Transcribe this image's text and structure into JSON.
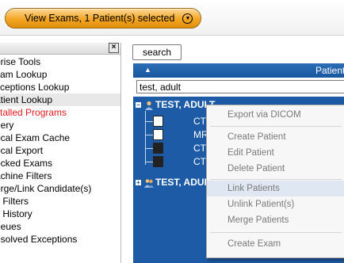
{
  "banner": {
    "button_label": "View Exams, 1 Patient(s) selected"
  },
  "left_panel": {
    "items": [
      {
        "label": "prise Tools"
      },
      {
        "label": "kam Lookup"
      },
      {
        "label": "xceptions Lookup"
      },
      {
        "label": "atient Lookup",
        "selected": true
      },
      {
        "label": "stalled Programs",
        "color": "#e5191f"
      },
      {
        "label": "uery"
      },
      {
        "label": "ocal Exam Cache"
      },
      {
        "label": "ocal Export"
      },
      {
        "label": "ocked Exams"
      },
      {
        "label": "achine Filters"
      },
      {
        "label": "erge/Link Candidate(s)"
      },
      {
        "label": "y Filters"
      },
      {
        "label": "y History"
      },
      {
        "label": "ueues"
      },
      {
        "label": "esolved Exceptions"
      }
    ]
  },
  "search": {
    "label": "search"
  },
  "patient_table": {
    "column_header": "Patient",
    "filter_value": "test, adult",
    "patients": [
      {
        "name": "TEST, ADULT",
        "expanded": true,
        "exams": [
          "CT",
          "MR",
          "CT",
          "CT"
        ]
      },
      {
        "name": "TEST, ADUL",
        "expanded": false
      }
    ]
  },
  "context_menu": {
    "items": [
      {
        "label": "Export via DICOM",
        "enabled": false
      },
      {
        "label": "Create Patient",
        "enabled": false
      },
      {
        "label": "Edit Patient",
        "enabled": false
      },
      {
        "label": "Delete Patient",
        "enabled": false
      },
      {
        "label": "Link Patients",
        "enabled": false,
        "highlighted": true
      },
      {
        "label": "Unlink Patient(s)",
        "enabled": false
      },
      {
        "label": "Merge Patients",
        "enabled": false
      },
      {
        "label": "Create Exam",
        "enabled": false
      }
    ]
  },
  "colors": {
    "accent": "#f5a623",
    "header_blue": "#1757a0",
    "tree_blue": "#1d5ba6",
    "red_item": "#e5191f"
  }
}
